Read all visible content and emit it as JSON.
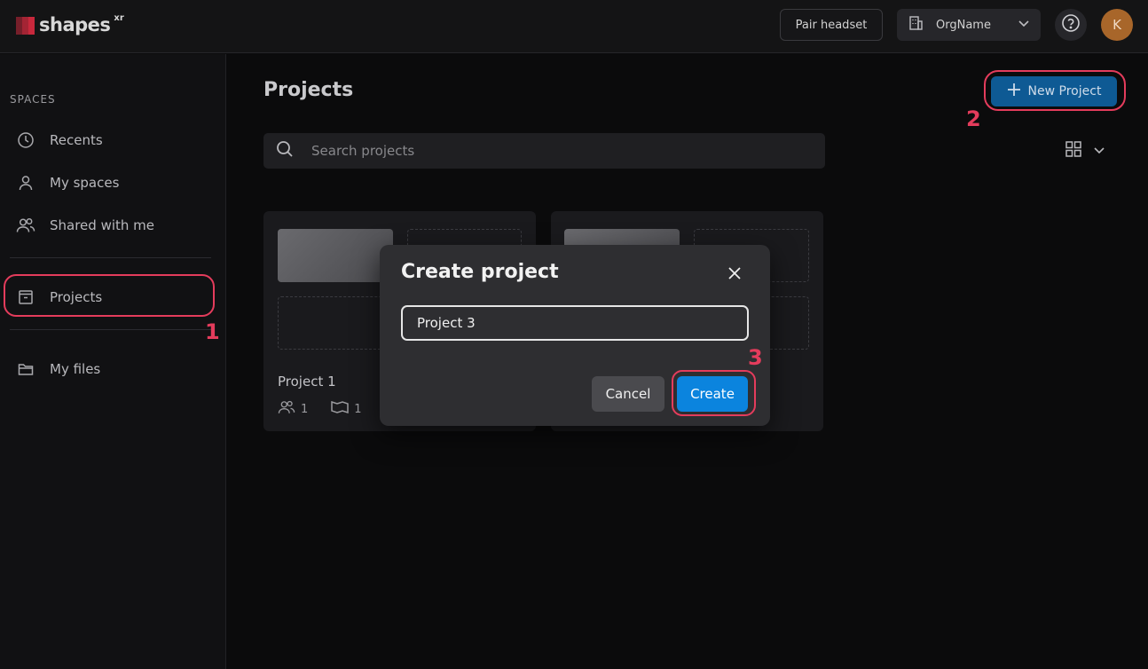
{
  "topbar": {
    "logo_text": "shapes",
    "logo_sup": "xr",
    "pair_label": "Pair headset",
    "org_name": "OrgName",
    "avatar_initial": "K"
  },
  "sidebar": {
    "section_title": "SPACES",
    "items": [
      {
        "label": "Recents",
        "icon": "clock-icon"
      },
      {
        "label": "My spaces",
        "icon": "user-icon"
      },
      {
        "label": "Shared with me",
        "icon": "users-icon"
      },
      {
        "label": "Projects",
        "icon": "project-box-icon"
      },
      {
        "label": "My files",
        "icon": "folder-icon"
      }
    ]
  },
  "main": {
    "title": "Projects",
    "new_project_label": "New Project",
    "search_placeholder": "Search projects",
    "cards": [
      {
        "title": "Project 1",
        "members": "1",
        "spaces": "1"
      }
    ]
  },
  "modal": {
    "title": "Create project",
    "input_value": "Project 3",
    "cancel_label": "Cancel",
    "create_label": "Create"
  },
  "annotations": {
    "step1": "1",
    "step2": "2",
    "step3": "3",
    "highlight_color": "#e43c5c"
  },
  "colors": {
    "accent": "#0b84de",
    "brand": "#c8283c"
  }
}
